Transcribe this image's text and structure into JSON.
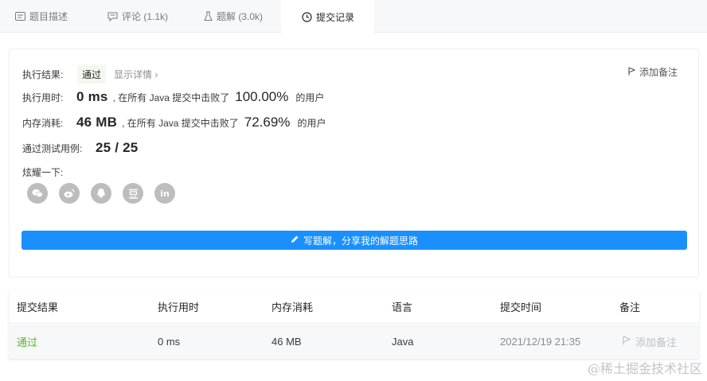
{
  "tabs": [
    {
      "label": "题目描述",
      "icon": "document-icon",
      "active": false
    },
    {
      "label": "评论 (1.1k)",
      "icon": "comment-icon",
      "active": false
    },
    {
      "label": "题解 (3.0k)",
      "icon": "flask-icon",
      "active": false
    },
    {
      "label": "提交记录",
      "icon": "clock-icon",
      "active": true
    }
  ],
  "result": {
    "label": "执行结果:",
    "status": "通过",
    "detail": "显示详情 ›",
    "add_note": "添加备注",
    "runtime_label": "执行用时:",
    "runtime_value": "0 ms",
    "beat_prefix": ", 在所有 Java 提交中击败了",
    "runtime_pct": "100.00%",
    "users_suffix": "的用户",
    "memory_label": "内存消耗:",
    "memory_value": "46 MB",
    "memory_pct": "72.69%",
    "tests_label": "通过测试用例:",
    "tests_value": "25 / 25",
    "share_label": "炫耀一下:",
    "share_icons": [
      "wechat-icon",
      "weibo-icon",
      "qq-icon",
      "douban-icon",
      "linkedin-icon"
    ],
    "write_button": "写题解，分享我的解题思路"
  },
  "table": {
    "headers": [
      "提交结果",
      "执行用时",
      "内存消耗",
      "语言",
      "提交时间",
      "备注"
    ],
    "rows": [
      {
        "status": "通过",
        "runtime": "0 ms",
        "memory": "46 MB",
        "language": "Java",
        "time": "2021/12/19 21:35",
        "note": "添加备注"
      }
    ]
  },
  "watermark": "@稀土掘金技术社区",
  "colors": {
    "accent": "#1a90ff",
    "success": "#5cb130"
  }
}
